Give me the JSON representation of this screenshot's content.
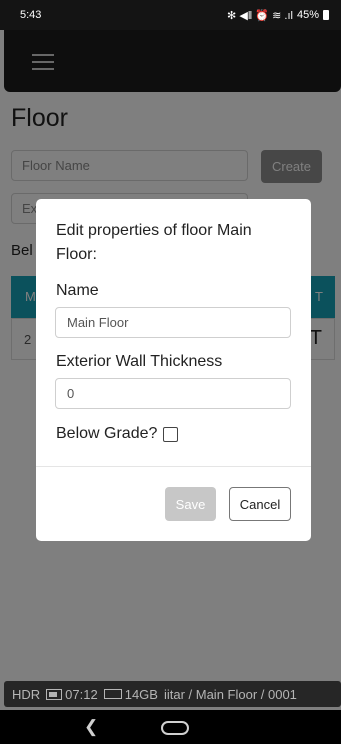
{
  "status_bar": {
    "time": "5:43",
    "icons": "✻ ◀ǁ ⏰ ≋ .ıl",
    "battery": "45%"
  },
  "page": {
    "title": "Floor",
    "floor_name_placeholder": "Floor Name",
    "create_label": "Create",
    "exterior_placeholder": "Ex",
    "below_label": "Bel",
    "table": {
      "header_col1": "M",
      "header_col2": "T",
      "row_col1": "2",
      "row_col2": "T"
    }
  },
  "modal": {
    "title": "Edit properties of floor Main Floor:",
    "name_label": "Name",
    "name_value": "Main Floor",
    "thickness_label": "Exterior Wall Thickness",
    "thickness_value": "0",
    "below_grade_label": "Below Grade?",
    "below_grade_checked": false,
    "save_label": "Save",
    "cancel_label": "Cancel"
  },
  "camera_bar": {
    "mode": "HDR",
    "time": "07:12",
    "storage": "14GB",
    "path": "iitar / Main Floor / 0001"
  },
  "nav_bar": {
    "back_icon": "back-icon",
    "home_icon": "home-icon"
  }
}
